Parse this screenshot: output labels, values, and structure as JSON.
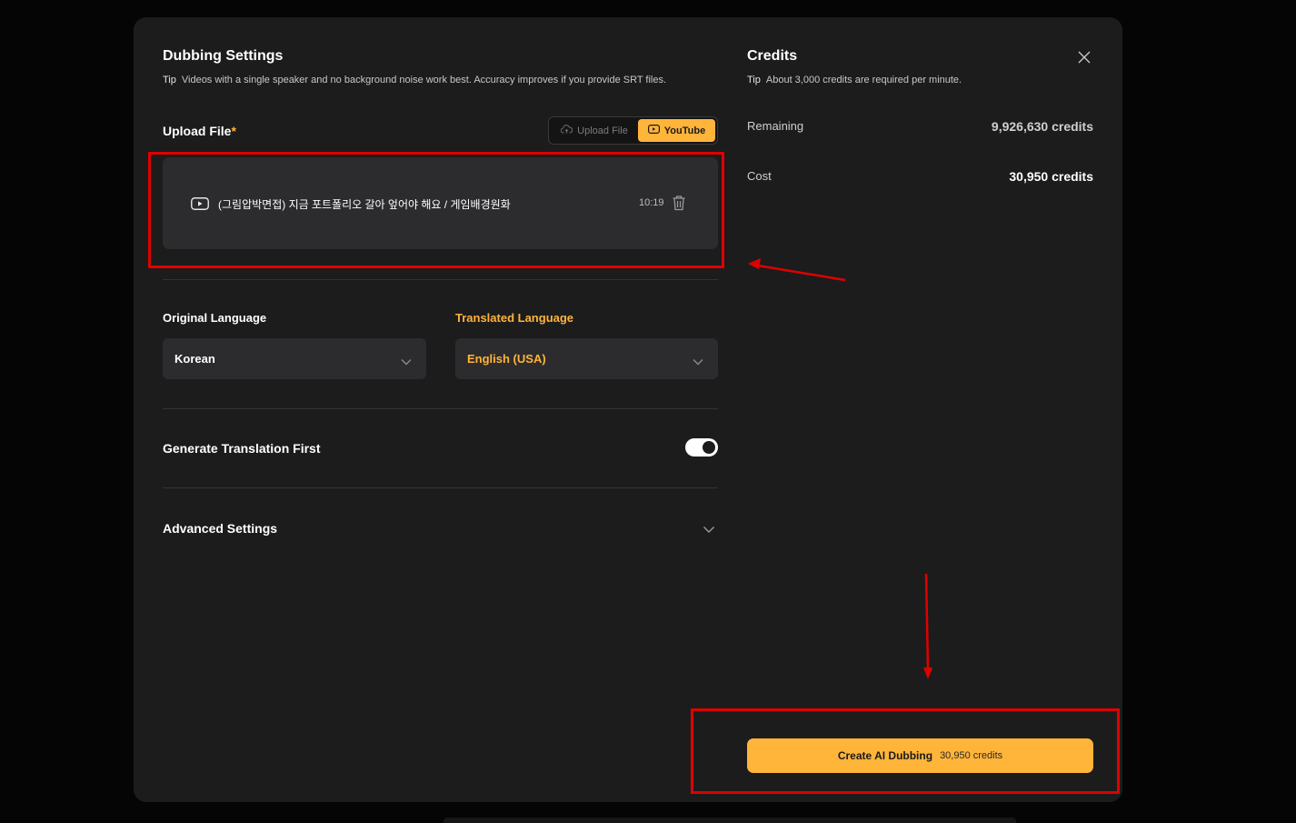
{
  "dubbing": {
    "title": "Dubbing Settings",
    "tip_key": "Tip",
    "tip_text": "Videos with a single speaker and no background noise work best. Accuracy improves if you provide SRT files."
  },
  "upload": {
    "label": "Upload File",
    "required_mark": "*",
    "source_options": [
      "Upload File",
      "YouTube"
    ],
    "selected_source": "YouTube",
    "file": {
      "name": "(그림압박면접) 지금 포트폴리오 갈아 엎어야 해요 / 게임배경원화",
      "duration": "10:19"
    }
  },
  "languages": {
    "original_label": "Original Language",
    "original_value": "Korean",
    "translated_label": "Translated Language",
    "translated_value": "English (USA)"
  },
  "generate_translation": {
    "label": "Generate Translation First",
    "enabled": true
  },
  "advanced": {
    "label": "Advanced Settings"
  },
  "credits": {
    "title": "Credits",
    "tip_key": "Tip",
    "tip_text": "About 3,000 credits are required per minute.",
    "remaining_label": "Remaining",
    "remaining_value": "9,926,630 credits",
    "cost_label": "Cost",
    "cost_value": "30,950 credits"
  },
  "create_button": {
    "label": "Create AI Dubbing",
    "cost": "30,950 credits"
  },
  "colors": {
    "accent": "#ffb43a",
    "modal_bg": "#1c1c1d",
    "annotation_red": "#e00000"
  },
  "icons": [
    "cloud-upload-icon",
    "youtube-icon",
    "play-icon",
    "trash-icon",
    "chevron-down-icon",
    "close-icon"
  ]
}
